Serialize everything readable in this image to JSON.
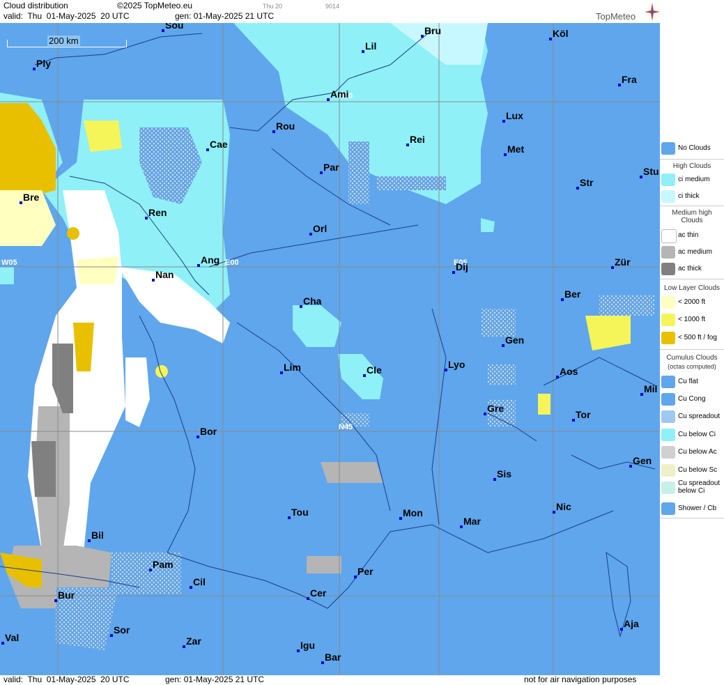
{
  "header": {
    "title": "Cloud distribution",
    "copyright": "©2025 TopMeteo.eu",
    "valid": "valid:  Thu  01-May-2025  20 UTC",
    "gen": "gen: 01-May-2025 21 UTC",
    "small1": "Thu 20",
    "small2": "9014",
    "logo": "TopMeteo"
  },
  "map": {
    "scale_label": "200 km",
    "grid_labels": [
      "N50",
      "W05",
      "E00",
      "E05",
      "N45"
    ],
    "cities": [
      {
        "name": "Sou"
      },
      {
        "name": "Bru"
      },
      {
        "name": "Köl"
      },
      {
        "name": "Ply"
      },
      {
        "name": "Lil"
      },
      {
        "name": "Fra"
      },
      {
        "name": "Ami"
      },
      {
        "name": "Lux"
      },
      {
        "name": "Rou"
      },
      {
        "name": "Cae"
      },
      {
        "name": "Rei"
      },
      {
        "name": "Met"
      },
      {
        "name": "Par"
      },
      {
        "name": "Stu"
      },
      {
        "name": "Bre"
      },
      {
        "name": "Str"
      },
      {
        "name": "Ren"
      },
      {
        "name": "Orl"
      },
      {
        "name": "Ang"
      },
      {
        "name": "Zür"
      },
      {
        "name": "Dij"
      },
      {
        "name": "Nan"
      },
      {
        "name": "Ber"
      },
      {
        "name": "Cha"
      },
      {
        "name": "Gen"
      },
      {
        "name": "Lim"
      },
      {
        "name": "Cle"
      },
      {
        "name": "Lyo"
      },
      {
        "name": "Aos"
      },
      {
        "name": "Mil"
      },
      {
        "name": "Gre"
      },
      {
        "name": "Tor"
      },
      {
        "name": "Bor"
      },
      {
        "name": "Gen"
      },
      {
        "name": "Sis"
      },
      {
        "name": "Nic"
      },
      {
        "name": "Tou"
      },
      {
        "name": "Mon"
      },
      {
        "name": "Mar"
      },
      {
        "name": "Bil"
      },
      {
        "name": "Pam"
      },
      {
        "name": "Per"
      },
      {
        "name": "Cil"
      },
      {
        "name": "Cer"
      },
      {
        "name": "Bur"
      },
      {
        "name": "Sor"
      },
      {
        "name": "Aja"
      },
      {
        "name": "Val"
      },
      {
        "name": "Zar"
      },
      {
        "name": "Igu"
      },
      {
        "name": "Bar"
      }
    ]
  },
  "legend": {
    "no_clouds": "No Clouds",
    "high_head": "High Clouds",
    "ci_medium": "ci medium",
    "ci_thick": "ci thick",
    "medium_head": "Medium high Clouds",
    "ac_thin": "ac thin",
    "ac_medium": "ac medium",
    "ac_thick": "ac thick",
    "low_head": "Low Layer Clouds",
    "low1": "< 2000 ft",
    "low2": "< 1000 ft",
    "low3": "< 500 ft / fog",
    "cu_head": "Cumulus Clouds",
    "cu_sub": "(octas computed)",
    "cu_flat": "Cu flat",
    "cu_cong": "Cu Cong",
    "cu_spread": "Cu spreadout",
    "cu_below_ci": "Cu below Ci",
    "cu_below_ac": "Cu below Ac",
    "cu_below_sc": "Cu below Sc",
    "cu_spread_ci": "Cu spreadout below Ci",
    "shower": "Shower / Cb"
  },
  "footer": {
    "valid": "valid:  Thu  01-May-2025  20 UTC",
    "gen": "gen: 01-May-2025 21 UTC",
    "note": "not for air navigation purposes"
  },
  "colors": {
    "no_clouds": "#5fa6ec",
    "ci_medium": "#8ff0f8",
    "ci_thick": "#c8f8ff",
    "ac_thin": "#ffffff",
    "ac_medium": "#b5b5b5",
    "ac_thick": "#808080",
    "low1": "#ffffc0",
    "low2": "#f5f55a",
    "low3": "#e8c000"
  }
}
